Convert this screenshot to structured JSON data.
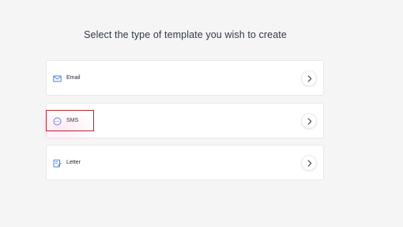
{
  "heading": "Select the type of template you wish to create",
  "options": [
    {
      "label": "Email",
      "icon": "email-icon"
    },
    {
      "label": "SMS",
      "icon": "sms-chat-icon"
    },
    {
      "label": "Letter",
      "icon": "letter-icon"
    }
  ],
  "colors": {
    "icon_blue": "#4a86d9",
    "highlight_red": "#b3292e",
    "background": "#f5f5f6"
  }
}
